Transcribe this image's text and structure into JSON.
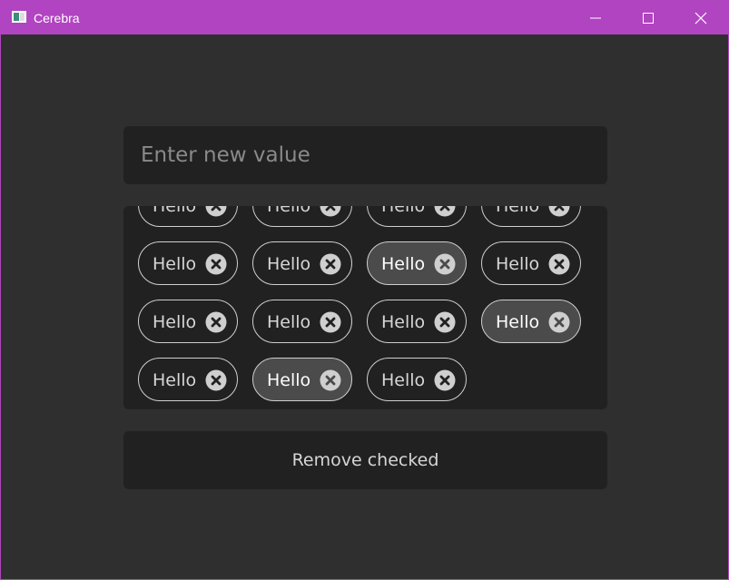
{
  "window": {
    "title": "Cerebra",
    "titlebar_color": "#b144c0",
    "background_color": "#2f2f2f",
    "controls": [
      "minimize-icon",
      "maximize-icon",
      "close-icon"
    ]
  },
  "input": {
    "placeholder": "Enter new value",
    "value": ""
  },
  "chips": {
    "remove_icon": "close-circle-icon",
    "items": [
      {
        "label": "Hello",
        "checked": false
      },
      {
        "label": "Hello",
        "checked": false
      },
      {
        "label": "Hello",
        "checked": false
      },
      {
        "label": "Hello",
        "checked": false
      },
      {
        "label": "Hello",
        "checked": false
      },
      {
        "label": "Hello",
        "checked": false
      },
      {
        "label": "Hello",
        "checked": true
      },
      {
        "label": "Hello",
        "checked": false
      },
      {
        "label": "Hello",
        "checked": false
      },
      {
        "label": "Hello",
        "checked": false
      },
      {
        "label": "Hello",
        "checked": false
      },
      {
        "label": "Hello",
        "checked": true
      },
      {
        "label": "Hello",
        "checked": false
      },
      {
        "label": "Hello",
        "checked": true
      },
      {
        "label": "Hello",
        "checked": false
      }
    ]
  },
  "actions": {
    "remove_checked_label": "Remove checked"
  }
}
